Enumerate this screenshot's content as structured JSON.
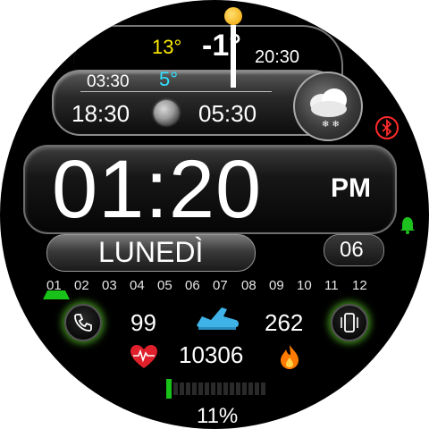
{
  "weather": {
    "high": "13°",
    "low": "5°",
    "current_temp": "-1°",
    "clock_right": "20:30",
    "clock_left": "03:30",
    "sunset": "18:30",
    "moonrise": "05:30",
    "weather_icon": "snow-cloud-icon",
    "sun_icon": "sun-icon",
    "moon_icon": "moon-icon"
  },
  "time": {
    "hours_minutes": "01:20",
    "ampm": "PM"
  },
  "date": {
    "weekday": "LUNEDÌ",
    "day": "06"
  },
  "month_strip": {
    "items": [
      "01",
      "02",
      "03",
      "04",
      "05",
      "06",
      "07",
      "08",
      "09",
      "10",
      "11",
      "12"
    ],
    "active_index": 0
  },
  "stats": {
    "heart_rate": "99",
    "steps": "10306",
    "calories": "262",
    "battery": "11%",
    "battery_fraction": 0.11
  },
  "icons": {
    "bluetooth": "bluetooth-icon",
    "alarm": "alarm-bell-icon",
    "phone": "phone-icon",
    "vibrate": "vibrate-phone-icon",
    "heart": "heart-rate-icon",
    "shoe": "running-shoe-icon",
    "flame": "flame-icon"
  },
  "colors": {
    "high": "#ffeb00",
    "low": "#2fe0ff",
    "accent_green": "#23c323",
    "heart": "#e0202a",
    "flame": "#ff7a00",
    "shoe": "#3fb3e8",
    "bluetooth": "#ff2a2a"
  }
}
